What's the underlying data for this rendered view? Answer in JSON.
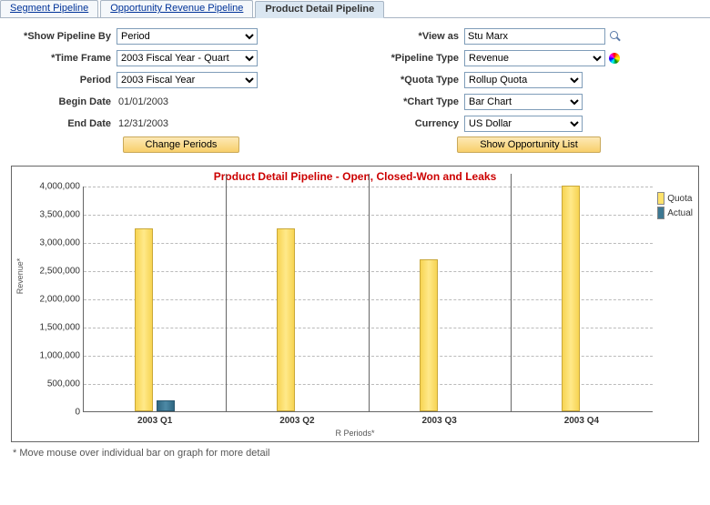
{
  "tabs": {
    "segment": "Segment Pipeline",
    "opportunity": "Opportunity Revenue Pipeline",
    "product": "Product Detail Pipeline"
  },
  "left": {
    "show_by_label": "Show Pipeline By",
    "show_by_value": "Period",
    "time_frame_label": "Time Frame",
    "time_frame_value": "2003 Fiscal Year - Quart",
    "period_label": "Period",
    "period_value": "2003 Fiscal Year",
    "begin_date_label": "Begin Date",
    "begin_date_value": "01/01/2003",
    "end_date_label": "End Date",
    "end_date_value": "12/31/2003",
    "change_periods_btn": "Change Periods"
  },
  "right": {
    "view_as_label": "View as",
    "view_as_value": "Stu Marx",
    "pipeline_type_label": "Pipeline Type",
    "pipeline_type_value": "Revenue",
    "quota_type_label": "Quota Type",
    "quota_type_value": "Rollup Quota",
    "chart_type_label": "Chart Type",
    "chart_type_value": "Bar Chart",
    "currency_label": "Currency",
    "currency_value": "US Dollar",
    "show_opp_btn": "Show Opportunity List"
  },
  "chart_meta": {
    "title": "Product Detail Pipeline - Open, Closed-Won and Leaks",
    "ylabel": "Revenue*",
    "xlabel": "R Periods*",
    "legend_quota": "Quota",
    "legend_actual": "Actual"
  },
  "yticks": [
    "0",
    "500,000",
    "1,000,000",
    "1,500,000",
    "2,000,000",
    "2,500,000",
    "3,000,000",
    "3,500,000",
    "4,000,000"
  ],
  "xcats": [
    "2003 Q1",
    "2003 Q2",
    "2003 Q3",
    "2003 Q4"
  ],
  "footnote": "* Move mouse over individual bar on graph for more detail",
  "chart_data": {
    "type": "bar",
    "title": "Product Detail Pipeline - Open, Closed-Won and Leaks",
    "xlabel": "R Periods*",
    "ylabel": "Revenue*",
    "ylim": [
      0,
      4000000
    ],
    "categories": [
      "2003 Q1",
      "2003 Q2",
      "2003 Q3",
      "2003 Q4"
    ],
    "series": [
      {
        "name": "Quota",
        "values": [
          3250000,
          3250000,
          2700000,
          4000000
        ]
      },
      {
        "name": "Actual",
        "values": [
          200000,
          0,
          0,
          0
        ]
      }
    ],
    "colors": {
      "Quota": "#ffe26b",
      "Actual": "#3d7892"
    }
  }
}
